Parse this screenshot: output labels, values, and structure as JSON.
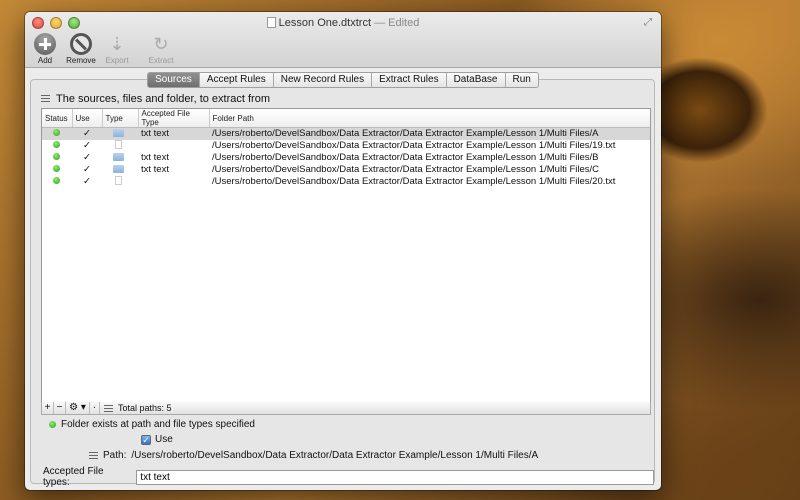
{
  "window": {
    "title": "Lesson One.dtxtrct",
    "title_suffix": "— Edited"
  },
  "toolbar": {
    "add_label": "Add",
    "remove_label": "Remove",
    "export_label": "Export",
    "extract_label": "Extract"
  },
  "tabs": [
    {
      "label": "Sources",
      "active": true
    },
    {
      "label": "Accept Rules"
    },
    {
      "label": "New Record Rules"
    },
    {
      "label": "Extract Rules"
    },
    {
      "label": "DataBase"
    },
    {
      "label": "Run"
    }
  ],
  "sources": {
    "heading": "The sources, files and folder, to extract from",
    "columns": [
      "Status",
      "Use",
      "Type",
      "Accepted File Type",
      "Folder Path"
    ],
    "rows": [
      {
        "use": "✓",
        "type": "folder",
        "file_type": "txt text",
        "path": "/Users/roberto/DevelSandbox/Data Extractor/Data Extractor Example/Lesson 1/Multi Files/A"
      },
      {
        "use": "✓",
        "type": "file",
        "file_type": "",
        "path": "/Users/roberto/DevelSandbox/Data Extractor/Data Extractor Example/Lesson 1/Multi Files/19.txt"
      },
      {
        "use": "✓",
        "type": "folder",
        "file_type": "txt text",
        "path": "/Users/roberto/DevelSandbox/Data Extractor/Data Extractor Example/Lesson 1/Multi Files/B"
      },
      {
        "use": "✓",
        "type": "folder",
        "file_type": "txt text",
        "path": "/Users/roberto/DevelSandbox/Data Extractor/Data Extractor Example/Lesson 1/Multi Files/C"
      },
      {
        "use": "✓",
        "type": "file",
        "file_type": "",
        "path": "/Users/roberto/DevelSandbox/Data Extractor/Data Extractor Example/Lesson 1/Multi Files/20.txt"
      }
    ],
    "footer": {
      "add": "+",
      "remove": "−",
      "gear": "⚙ ▾",
      "total_paths": "Total paths: 5"
    }
  },
  "details": {
    "status_text": "Folder exists at path and file types specified",
    "use_label": "Use",
    "path_label": "Path:",
    "path_value": "/Users/roberto/DevelSandbox/Data Extractor/Data Extractor Example/Lesson 1/Multi Files/A",
    "accepted_label": "Accepted File types:",
    "accepted_value": "txt text"
  },
  "colors": {
    "status_ok": "#2e9a1d",
    "tab_active": "#7a7a7a"
  }
}
